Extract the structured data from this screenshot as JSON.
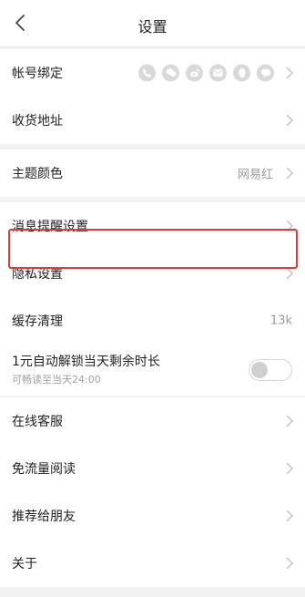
{
  "header": {
    "title": "设置"
  },
  "group1": {
    "account": {
      "label": "帐号绑定",
      "icons": [
        "phone-icon",
        "wechat-icon",
        "weibo-icon",
        "mail-icon",
        "qq-icon",
        "yixin-icon"
      ]
    },
    "address": {
      "label": "收货地址"
    }
  },
  "group2": {
    "theme": {
      "label": "主题颜色",
      "value": "网易红"
    }
  },
  "group3": {
    "notifications": {
      "label": "消息提醒设置"
    },
    "privacy": {
      "label": "隐私设置"
    },
    "cache": {
      "label": "缓存清理",
      "value": "13k"
    },
    "auto_unlock": {
      "label": "1元自动解锁当天剩余时长",
      "sublabel": "可畅读至当天24:00",
      "enabled": false
    }
  },
  "group4": {
    "support": {
      "label": "在线客服"
    },
    "free_data": {
      "label": "免流量阅读"
    },
    "recommend": {
      "label": "推荐给朋友"
    },
    "about": {
      "label": "关于"
    }
  },
  "colors": {
    "accent_highlight": "#e53935",
    "icon_gray": "#d9d9d9",
    "value_gray": "#9a9a9a"
  }
}
